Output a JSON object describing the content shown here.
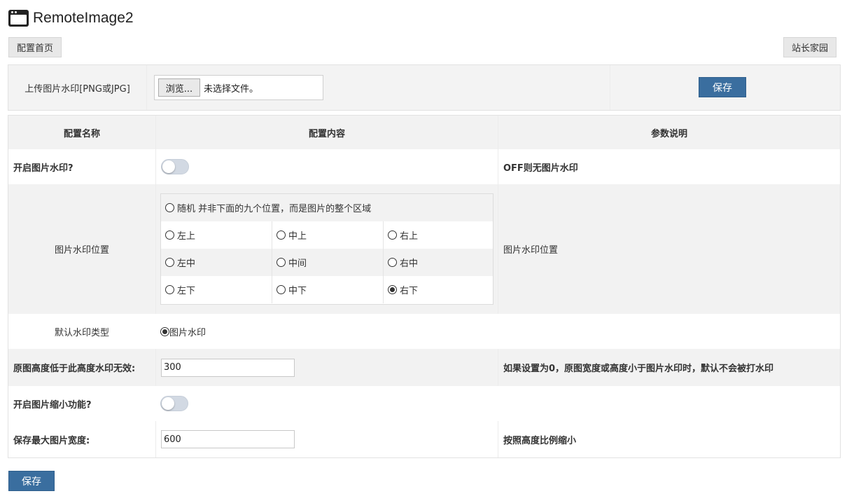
{
  "header": {
    "title": "RemoteImage2",
    "icon": "app-window-icon"
  },
  "nav": {
    "config_home": "配置首页",
    "webmaster_home": "站长家园"
  },
  "upload": {
    "label": "上传图片水印[PNG或JPG]",
    "browse_label": "浏览...",
    "file_status": "未选择文件。",
    "save_label": "保存"
  },
  "table": {
    "headers": {
      "name": "配置名称",
      "content": "配置内容",
      "desc": "参数说明"
    },
    "enable_watermark": {
      "label": "开启图片水印?",
      "state": "off",
      "desc": "OFF则无图片水印"
    },
    "position": {
      "label": "图片水印位置",
      "random_label": "随机  并非下面的九个位置，而是图片的整个区域",
      "options": {
        "top_left": "左上",
        "top_center": "中上",
        "top_right": "右上",
        "mid_left": "左中",
        "mid_center": "中间",
        "mid_right": "右中",
        "bottom_left": "左下",
        "bottom_center": "中下",
        "bottom_right": "右下"
      },
      "selected": "bottom_right",
      "desc": "图片水印位置"
    },
    "default_type": {
      "label": "默认水印类型",
      "option": "图片水印"
    },
    "min_height": {
      "label": "原图高度低于此高度水印无效:",
      "value": "300",
      "desc": "如果设置为0，原图宽度或高度小于图片水印时，默认不会被打水印"
    },
    "enable_resize": {
      "label": "开启图片缩小功能?",
      "state": "off"
    },
    "max_width": {
      "label": "保存最大图片宽度:",
      "value": "600",
      "desc": "按照高度比例缩小"
    }
  },
  "footer": {
    "save_label": "保存"
  },
  "colors": {
    "primary_button": "#3a6e9f",
    "row_stripe": "#f2f2f2",
    "toggle_off": "#d2d9e3"
  }
}
